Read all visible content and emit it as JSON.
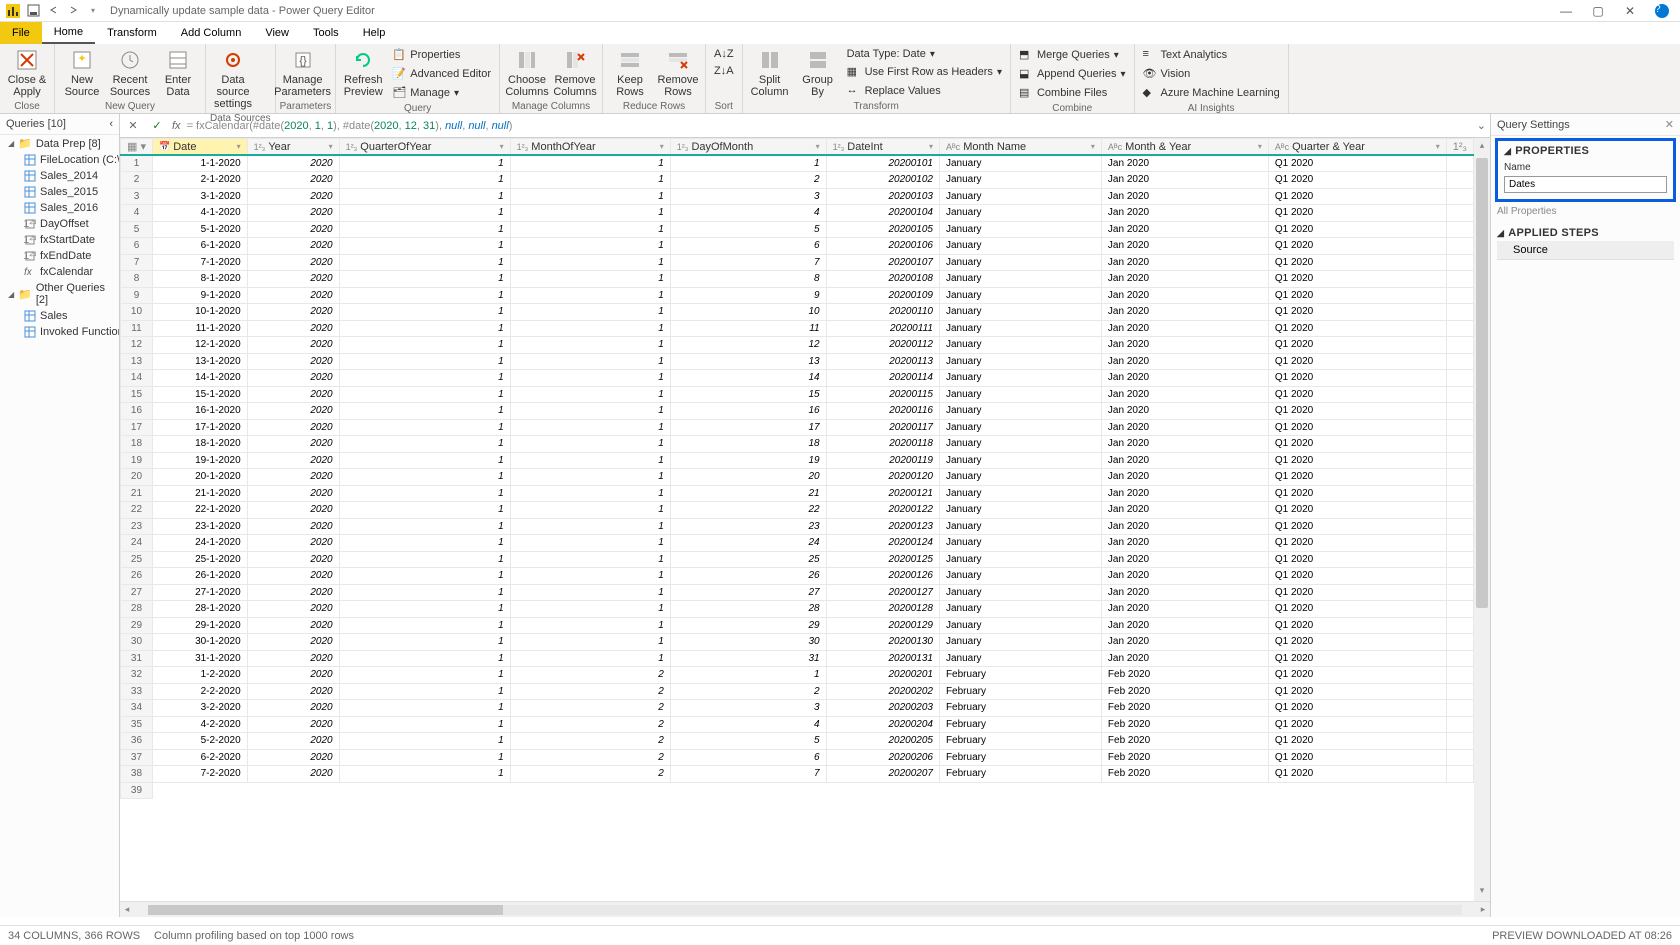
{
  "titlebar": {
    "title": "Dynamically update sample data - Power Query Editor"
  },
  "menubar": {
    "file": "File",
    "tabs": [
      "Home",
      "Transform",
      "Add Column",
      "View",
      "Tools",
      "Help"
    ],
    "active": 0
  },
  "ribbon": {
    "close": "Close &\nApply",
    "new_source": "New\nSource",
    "recent_sources": "Recent\nSources",
    "enter_data": "Enter\nData",
    "data_source_settings": "Data source\nsettings",
    "manage_parameters": "Manage\nParameters",
    "refresh_preview": "Refresh\nPreview",
    "properties": "Properties",
    "advanced_editor": "Advanced Editor",
    "manage": "Manage",
    "choose_columns": "Choose\nColumns",
    "remove_columns": "Remove\nColumns",
    "keep_rows": "Keep\nRows",
    "remove_rows": "Remove\nRows",
    "sort": "Sort",
    "split_column": "Split\nColumn",
    "group_by": "Group\nBy",
    "data_type": "Data Type: Date",
    "use_first_row": "Use First Row as Headers",
    "replace_values": "Replace Values",
    "merge_queries": "Merge Queries",
    "append_queries": "Append Queries",
    "combine_files": "Combine Files",
    "text_analytics": "Text Analytics",
    "vision": "Vision",
    "azure_ml": "Azure Machine Learning",
    "groups": {
      "close": "Close",
      "new_query": "New Query",
      "data_sources": "Data Sources",
      "parameters": "Parameters",
      "query": "Query",
      "manage_columns": "Manage Columns",
      "reduce_rows": "Reduce Rows",
      "sort_g": "Sort",
      "transform": "Transform",
      "combine": "Combine",
      "ai": "AI Insights"
    }
  },
  "queries": {
    "header": "Queries [10]",
    "groups": [
      {
        "name": "Data Prep [8]",
        "folder": true,
        "items": [
          "FileLocation (C:\\...",
          "Sales_2014",
          "Sales_2015",
          "Sales_2016",
          "DayOffset",
          "fxStartDate",
          "fxEndDate",
          "fxCalendar"
        ],
        "kinds": [
          "t",
          "t",
          "t",
          "t",
          "p",
          "p",
          "p",
          "f"
        ]
      },
      {
        "name": "Other Queries [2]",
        "folder": true,
        "items": [
          "Sales",
          "Invoked Function"
        ],
        "kinds": [
          "t",
          "t"
        ]
      }
    ]
  },
  "formula": {
    "prefix": "= fxCalendar(#date(",
    "a1": "2020",
    "c1": ", ",
    "a2": "1",
    "c2": ", ",
    "a3": "1",
    "mid": "), #date(",
    "b1": "2020",
    "c3": ", ",
    "b2": "12",
    "c4": ", ",
    "b3": "31",
    "suffix": "), ",
    "n1": "null",
    "c5": ", ",
    "n2": "null",
    "c6": ", ",
    "n3": "null",
    "end": ")"
  },
  "grid": {
    "columns": [
      {
        "name": "Date",
        "type": "date",
        "sel": true
      },
      {
        "name": "Year",
        "type": "123"
      },
      {
        "name": "QuarterOfYear",
        "type": "123"
      },
      {
        "name": "MonthOfYear",
        "type": "123"
      },
      {
        "name": "DayOfMonth",
        "type": "123"
      },
      {
        "name": "DateInt",
        "type": "123"
      },
      {
        "name": "Month Name",
        "type": "ABC"
      },
      {
        "name": "Month & Year",
        "type": "ABC"
      },
      {
        "name": "Quarter & Year",
        "type": "ABC"
      }
    ],
    "rows": [
      [
        "1-1-2020",
        "2020",
        "1",
        "1",
        "1",
        "20200101",
        "January",
        "Jan 2020",
        "Q1 2020"
      ],
      [
        "2-1-2020",
        "2020",
        "1",
        "1",
        "2",
        "20200102",
        "January",
        "Jan 2020",
        "Q1 2020"
      ],
      [
        "3-1-2020",
        "2020",
        "1",
        "1",
        "3",
        "20200103",
        "January",
        "Jan 2020",
        "Q1 2020"
      ],
      [
        "4-1-2020",
        "2020",
        "1",
        "1",
        "4",
        "20200104",
        "January",
        "Jan 2020",
        "Q1 2020"
      ],
      [
        "5-1-2020",
        "2020",
        "1",
        "1",
        "5",
        "20200105",
        "January",
        "Jan 2020",
        "Q1 2020"
      ],
      [
        "6-1-2020",
        "2020",
        "1",
        "1",
        "6",
        "20200106",
        "January",
        "Jan 2020",
        "Q1 2020"
      ],
      [
        "7-1-2020",
        "2020",
        "1",
        "1",
        "7",
        "20200107",
        "January",
        "Jan 2020",
        "Q1 2020"
      ],
      [
        "8-1-2020",
        "2020",
        "1",
        "1",
        "8",
        "20200108",
        "January",
        "Jan 2020",
        "Q1 2020"
      ],
      [
        "9-1-2020",
        "2020",
        "1",
        "1",
        "9",
        "20200109",
        "January",
        "Jan 2020",
        "Q1 2020"
      ],
      [
        "10-1-2020",
        "2020",
        "1",
        "1",
        "10",
        "20200110",
        "January",
        "Jan 2020",
        "Q1 2020"
      ],
      [
        "11-1-2020",
        "2020",
        "1",
        "1",
        "11",
        "20200111",
        "January",
        "Jan 2020",
        "Q1 2020"
      ],
      [
        "12-1-2020",
        "2020",
        "1",
        "1",
        "12",
        "20200112",
        "January",
        "Jan 2020",
        "Q1 2020"
      ],
      [
        "13-1-2020",
        "2020",
        "1",
        "1",
        "13",
        "20200113",
        "January",
        "Jan 2020",
        "Q1 2020"
      ],
      [
        "14-1-2020",
        "2020",
        "1",
        "1",
        "14",
        "20200114",
        "January",
        "Jan 2020",
        "Q1 2020"
      ],
      [
        "15-1-2020",
        "2020",
        "1",
        "1",
        "15",
        "20200115",
        "January",
        "Jan 2020",
        "Q1 2020"
      ],
      [
        "16-1-2020",
        "2020",
        "1",
        "1",
        "16",
        "20200116",
        "January",
        "Jan 2020",
        "Q1 2020"
      ],
      [
        "17-1-2020",
        "2020",
        "1",
        "1",
        "17",
        "20200117",
        "January",
        "Jan 2020",
        "Q1 2020"
      ],
      [
        "18-1-2020",
        "2020",
        "1",
        "1",
        "18",
        "20200118",
        "January",
        "Jan 2020",
        "Q1 2020"
      ],
      [
        "19-1-2020",
        "2020",
        "1",
        "1",
        "19",
        "20200119",
        "January",
        "Jan 2020",
        "Q1 2020"
      ],
      [
        "20-1-2020",
        "2020",
        "1",
        "1",
        "20",
        "20200120",
        "January",
        "Jan 2020",
        "Q1 2020"
      ],
      [
        "21-1-2020",
        "2020",
        "1",
        "1",
        "21",
        "20200121",
        "January",
        "Jan 2020",
        "Q1 2020"
      ],
      [
        "22-1-2020",
        "2020",
        "1",
        "1",
        "22",
        "20200122",
        "January",
        "Jan 2020",
        "Q1 2020"
      ],
      [
        "23-1-2020",
        "2020",
        "1",
        "1",
        "23",
        "20200123",
        "January",
        "Jan 2020",
        "Q1 2020"
      ],
      [
        "24-1-2020",
        "2020",
        "1",
        "1",
        "24",
        "20200124",
        "January",
        "Jan 2020",
        "Q1 2020"
      ],
      [
        "25-1-2020",
        "2020",
        "1",
        "1",
        "25",
        "20200125",
        "January",
        "Jan 2020",
        "Q1 2020"
      ],
      [
        "26-1-2020",
        "2020",
        "1",
        "1",
        "26",
        "20200126",
        "January",
        "Jan 2020",
        "Q1 2020"
      ],
      [
        "27-1-2020",
        "2020",
        "1",
        "1",
        "27",
        "20200127",
        "January",
        "Jan 2020",
        "Q1 2020"
      ],
      [
        "28-1-2020",
        "2020",
        "1",
        "1",
        "28",
        "20200128",
        "January",
        "Jan 2020",
        "Q1 2020"
      ],
      [
        "29-1-2020",
        "2020",
        "1",
        "1",
        "29",
        "20200129",
        "January",
        "Jan 2020",
        "Q1 2020"
      ],
      [
        "30-1-2020",
        "2020",
        "1",
        "1",
        "30",
        "20200130",
        "January",
        "Jan 2020",
        "Q1 2020"
      ],
      [
        "31-1-2020",
        "2020",
        "1",
        "1",
        "31",
        "20200131",
        "January",
        "Jan 2020",
        "Q1 2020"
      ],
      [
        "1-2-2020",
        "2020",
        "1",
        "2",
        "1",
        "20200201",
        "February",
        "Feb 2020",
        "Q1 2020"
      ],
      [
        "2-2-2020",
        "2020",
        "1",
        "2",
        "2",
        "20200202",
        "February",
        "Feb 2020",
        "Q1 2020"
      ],
      [
        "3-2-2020",
        "2020",
        "1",
        "2",
        "3",
        "20200203",
        "February",
        "Feb 2020",
        "Q1 2020"
      ],
      [
        "4-2-2020",
        "2020",
        "1",
        "2",
        "4",
        "20200204",
        "February",
        "Feb 2020",
        "Q1 2020"
      ],
      [
        "5-2-2020",
        "2020",
        "1",
        "2",
        "5",
        "20200205",
        "February",
        "Feb 2020",
        "Q1 2020"
      ],
      [
        "6-2-2020",
        "2020",
        "1",
        "2",
        "6",
        "20200206",
        "February",
        "Feb 2020",
        "Q1 2020"
      ],
      [
        "7-2-2020",
        "2020",
        "1",
        "2",
        "7",
        "20200207",
        "February",
        "Feb 2020",
        "Q1 2020"
      ]
    ],
    "extra_row": "39"
  },
  "settings": {
    "header": "Query Settings",
    "properties": "PROPERTIES",
    "name_label": "Name",
    "name_value": "Dates",
    "all_properties": "All Properties",
    "applied_steps": "APPLIED STEPS",
    "steps": [
      "Source"
    ]
  },
  "statusbar": {
    "left1": "34 COLUMNS, 366 ROWS",
    "left2": "Column profiling based on top 1000 rows",
    "right": "PREVIEW DOWNLOADED AT 08:26"
  },
  "italic_cols": [
    1,
    2,
    3,
    4,
    5
  ]
}
